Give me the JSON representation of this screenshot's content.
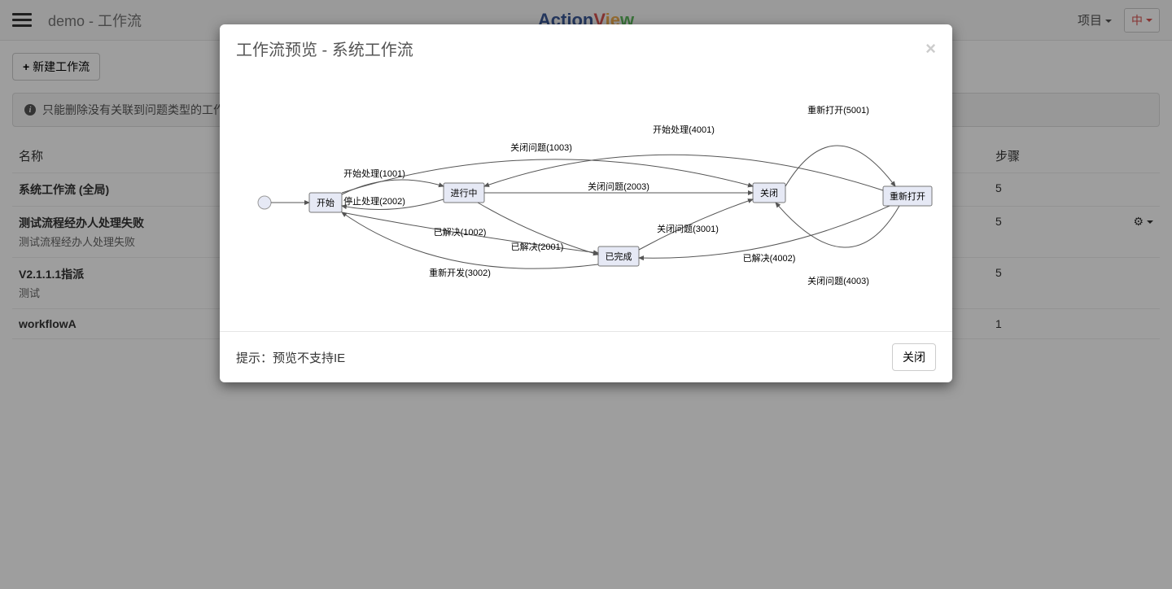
{
  "navbar": {
    "breadcrumb": "demo - 工作流",
    "brand_parts": [
      "Action",
      "V",
      "ie",
      "w"
    ],
    "project_dropdown": "项目",
    "lang_label": "中"
  },
  "toolbar": {
    "new_workflow": "新建工作流"
  },
  "info_banner": "只能删除没有关联到问题类型的工作流。",
  "table": {
    "col_name": "名称",
    "col_steps": "步骤",
    "rows": [
      {
        "title": "系统工作流 (全局)",
        "sub": "",
        "steps": "5"
      },
      {
        "title": "测试流程经办人处理失败",
        "sub": "测试流程经办人处理失败",
        "steps": "5"
      },
      {
        "title": "V2.1.1.1指派",
        "sub": "测试",
        "steps": "5"
      },
      {
        "title": "workflowA",
        "sub": "",
        "steps": "1"
      }
    ]
  },
  "modal": {
    "title": "工作流预览 - 系统工作流",
    "hint": "提示：预览不支持IE",
    "close_btn": "关闭",
    "nodes": {
      "start": "开始",
      "in_progress": "进行中",
      "done": "已完成",
      "closed": "关闭",
      "reopened": "重新打开"
    },
    "edges": {
      "e1001": "开始处理(1001)",
      "e2002": "停止处理(2002)",
      "e1003": "关闭问题(1003)",
      "e1002": "已解决(1002)",
      "e2001": "已解决(2001)",
      "e3002": "重新开发(3002)",
      "e2003": "关闭问题(2003)",
      "e3001": "关闭问题(3001)",
      "e4001": "开始处理(4001)",
      "e4002": "已解决(4002)",
      "e4003": "关闭问题(4003)",
      "e5001": "重新打开(5001)"
    }
  }
}
